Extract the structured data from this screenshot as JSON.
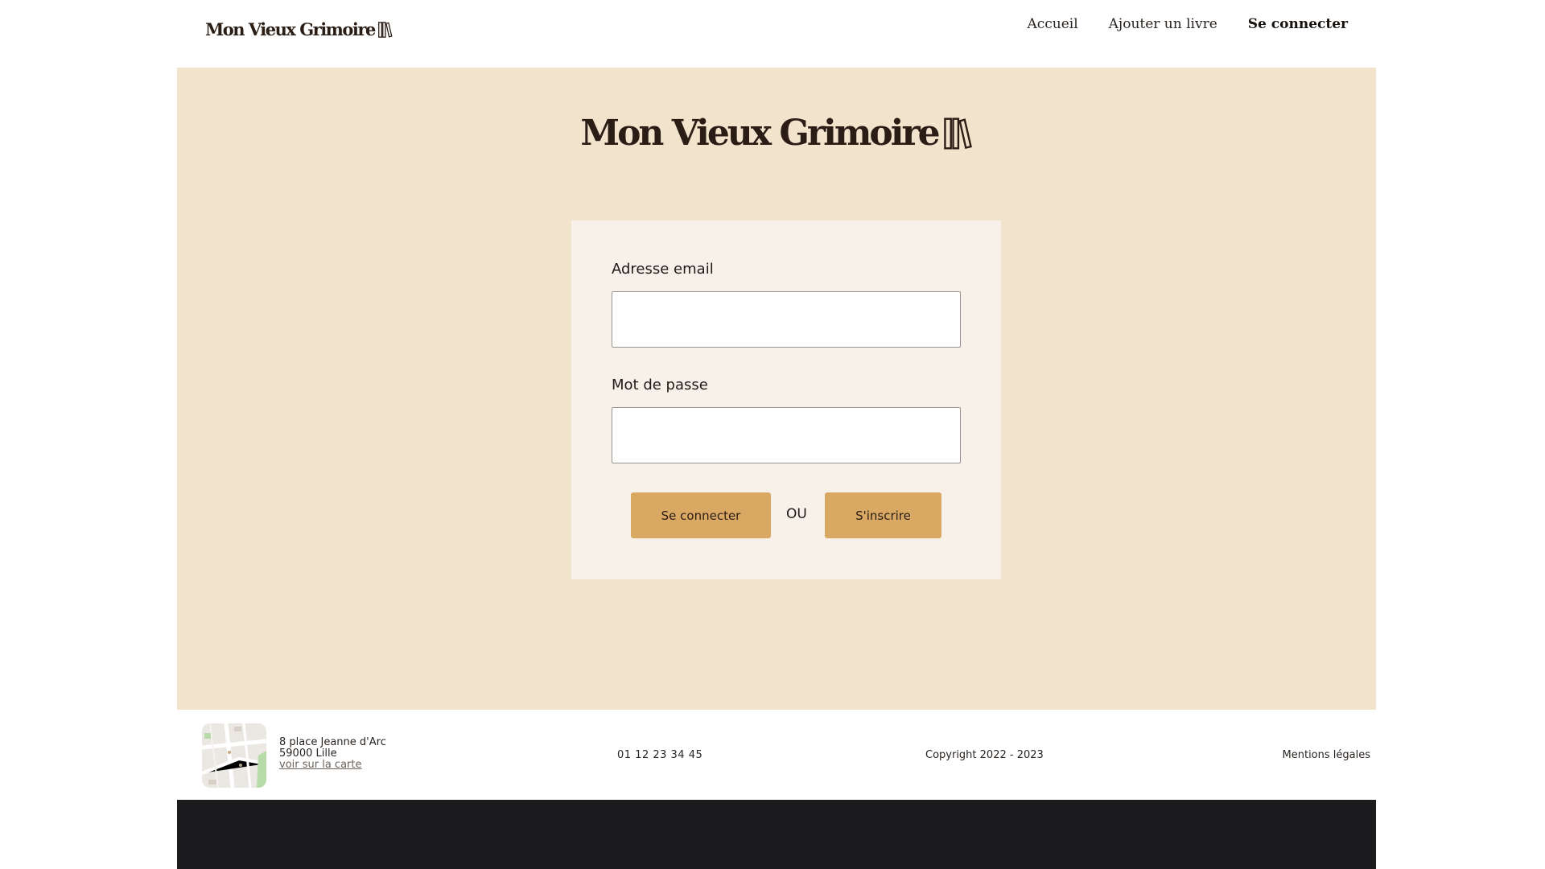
{
  "header": {
    "logo_text": "Mon Vieux Grimoire",
    "nav": {
      "home": "Accueil",
      "add_book": "Ajouter un livre",
      "login": "Se connecter"
    }
  },
  "main": {
    "hero_logo_text": "Mon Vieux Grimoire",
    "form": {
      "email_label": "Adresse email",
      "email_value": "",
      "password_label": "Mot de passe",
      "password_value": "",
      "login_button": "Se connecter",
      "or_text": "OU",
      "signup_button": "S'inscrire"
    }
  },
  "footer": {
    "address_line1": "8 place Jeanne d'Arc",
    "address_line2": "59000 Lille",
    "map_link": "voir sur la carte",
    "phone": "01 12 23 34 45",
    "copyright": "Copyright 2022 - 2023",
    "legal": "Mentions légales"
  },
  "colors": {
    "main_background": "#f2e3cc",
    "card_background": "#f7f1ea",
    "button": "#d9a863",
    "logo": "#2a1d15",
    "bottom_bar": "#1c1c1e"
  },
  "icons": {
    "logo": "books-icon",
    "map": "map-thumbnail"
  }
}
